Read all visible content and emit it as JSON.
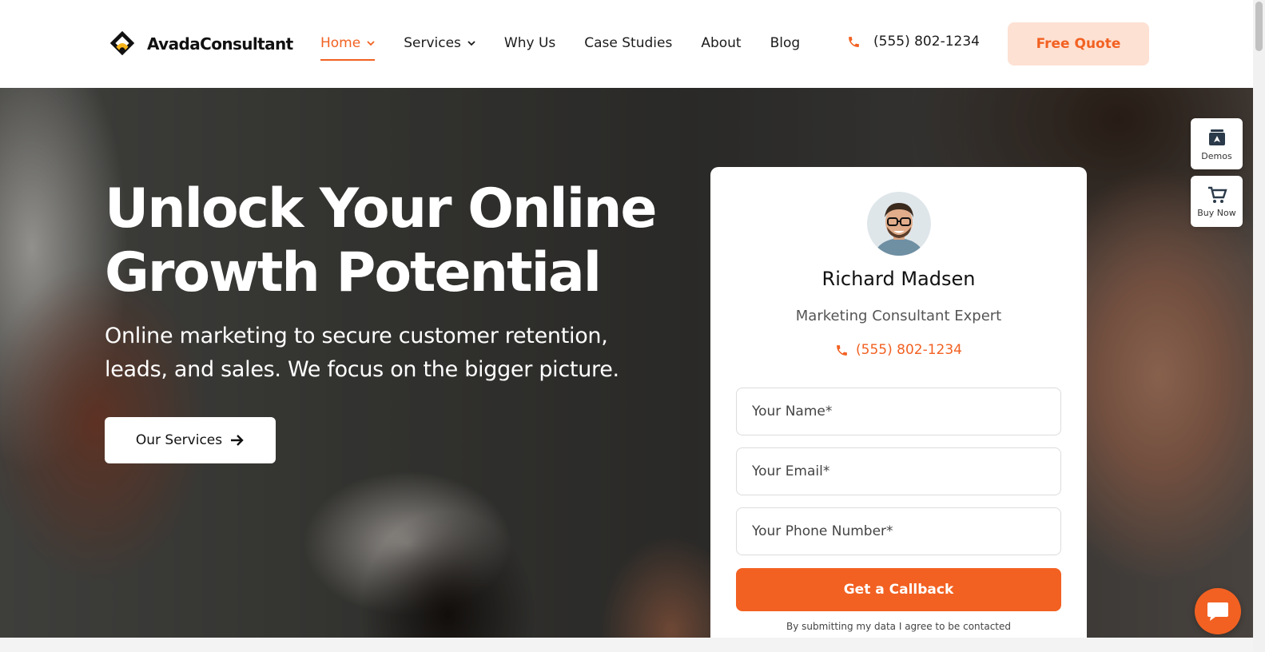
{
  "brand": {
    "name": "AvadaConsultant"
  },
  "nav": {
    "items": [
      {
        "label": "Home",
        "has_dropdown": true,
        "active": true
      },
      {
        "label": "Services",
        "has_dropdown": true,
        "active": false
      },
      {
        "label": "Why Us",
        "has_dropdown": false,
        "active": false
      },
      {
        "label": "Case Studies",
        "has_dropdown": false,
        "active": false
      },
      {
        "label": "About",
        "has_dropdown": false,
        "active": false
      },
      {
        "label": "Blog",
        "has_dropdown": false,
        "active": false
      }
    ],
    "phone": "(555) 802-1234",
    "cta_label": "Free Quote"
  },
  "hero": {
    "title": "Unlock Your Online Growth Potential",
    "subtitle": "Online marketing to secure customer retention, leads, and sales. We focus on the bigger picture.",
    "button_label": "Our Services"
  },
  "side_widgets": {
    "demos_label": "Demos",
    "buy_label": "Buy Now"
  },
  "card": {
    "name": "Richard Madsen",
    "role": "Marketing Consultant Expert",
    "phone": "(555) 802-1234",
    "fields": {
      "name_placeholder": "Your Name*",
      "email_placeholder": "Your Email*",
      "phone_placeholder": "Your Phone Number*"
    },
    "submit_label": "Get a Callback",
    "consent": "By submitting my data I agree to be contacted"
  },
  "colors": {
    "accent": "#f26122",
    "accent_light": "#fde1d3"
  },
  "icons": [
    "logo-mark-icon",
    "chevron-down-icon",
    "phone-icon",
    "arrow-right-icon",
    "demos-icon",
    "cart-icon",
    "chat-icon"
  ]
}
